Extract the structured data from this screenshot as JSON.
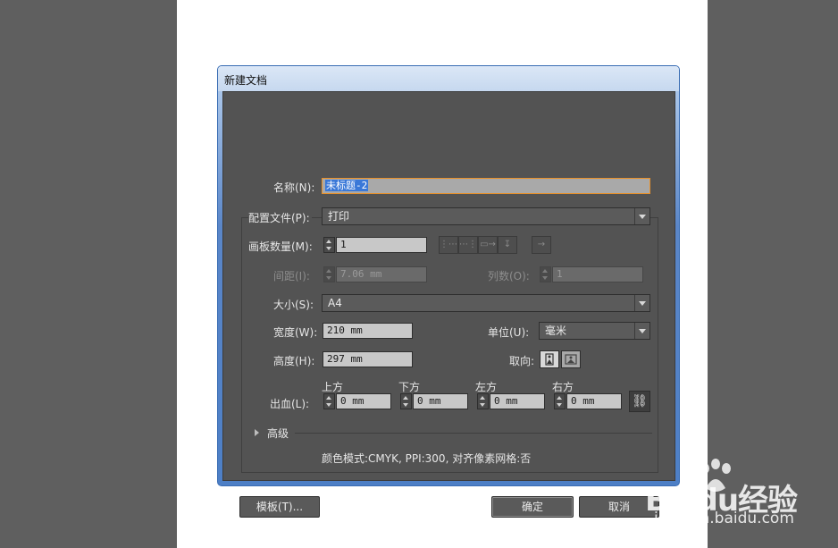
{
  "dialog": {
    "title": "新建文档",
    "name_label": "名称(N):",
    "name_value": "未标题-2",
    "profile_label": "配置文件(P):",
    "profile_value": "打印",
    "artboards_label": "画板数量(M):",
    "artboards_value": "1",
    "spacing_label": "间距(I):",
    "spacing_value": "7.06 mm",
    "columns_label": "列数(O):",
    "columns_value": "1",
    "size_label": "大小(S):",
    "size_value": "A4",
    "width_label": "宽度(W):",
    "width_value": "210 mm",
    "units_label": "单位(U):",
    "units_value": "毫米",
    "height_label": "高度(H):",
    "height_value": "297 mm",
    "orientation_label": "取向:",
    "bleed_label": "出血(L):",
    "bleed": [
      {
        "label": "上方",
        "value": "0 mm"
      },
      {
        "label": "下方",
        "value": "0 mm"
      },
      {
        "label": "左方",
        "value": "0 mm"
      },
      {
        "label": "右方",
        "value": "0 mm"
      }
    ],
    "advanced_label": "高级",
    "color_info": "颜色模式:CMYK, PPI:300, 对齐像素网格:否",
    "templates_button": "模板(T)...",
    "ok_button": "确定",
    "cancel_button": "取消"
  },
  "watermark": {
    "brand": "Baidu经验",
    "url": "jingyan.baidu.com"
  },
  "colors": {
    "dialog_bg": "#535353",
    "focus_border": "#e8912a",
    "selection": "#3a78d8"
  }
}
